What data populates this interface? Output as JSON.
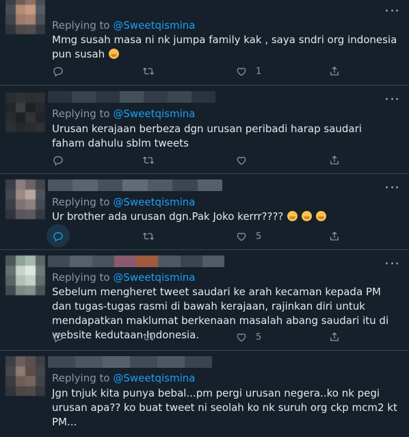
{
  "colors": {
    "background": "#15202b",
    "divider": "#38444d",
    "handle": "#1da1f2",
    "muted": "#8b98a5",
    "text": "#e7e9ea"
  },
  "icons": {
    "reply": "reply-icon",
    "retweet": "retweet-icon",
    "like": "heart-icon",
    "share": "share-icon",
    "more": "more-options-icon"
  },
  "tweets": [
    {
      "replying_prefix": "Replying to",
      "replying_handle": "@Sweetqismina",
      "text": "Mmg susah masa ni nk jumpa family kak , saya sndri org indonesia pun susah",
      "emoji": "sad-face-emoji",
      "reply_count": "",
      "retweet_count": "",
      "like_count": "1"
    },
    {
      "replying_prefix": "Replying to",
      "replying_handle": "@Sweetqismina",
      "text": "Urusan kerajaan berbeza dgn urusan peribadi harap saudari faham dahulu sblm tweets",
      "reply_count": "",
      "retweet_count": "",
      "like_count": ""
    },
    {
      "replying_prefix": "Replying to",
      "replying_handle": "@Sweetqismina",
      "text": "Ur brother ada urusan dgn.Pak Joko kerrr????",
      "emoji": "face-with-hand-over-mouth-emoji x3",
      "reply_count": "",
      "retweet_count": "",
      "like_count": "5"
    },
    {
      "replying_prefix": "Replying to",
      "replying_handle": "@Sweetqismina",
      "text": "Sebelum mengheret tweet saudari ke arah kecaman kepada PM dan tugas-tugas rasmi di bawah kerajaan, rajinkan diri untuk mendapatkan maklumat berkenaan masalah abang saudari itu di website kedutaan Indonesia.",
      "reply_count": "",
      "retweet_count": "",
      "like_count": "5"
    },
    {
      "replying_prefix": "Replying to",
      "replying_handle": "@Sweetqismina",
      "text": "Jgn tnjuk kita punya bebal...pm pergi urusan negera..ko nk pegi urusan apa?? ko buat tweet ni seolah ko nk suruh org ckp mcm2 kt PM...",
      "reply_count": "",
      "retweet_count": "",
      "like_count": ""
    }
  ]
}
